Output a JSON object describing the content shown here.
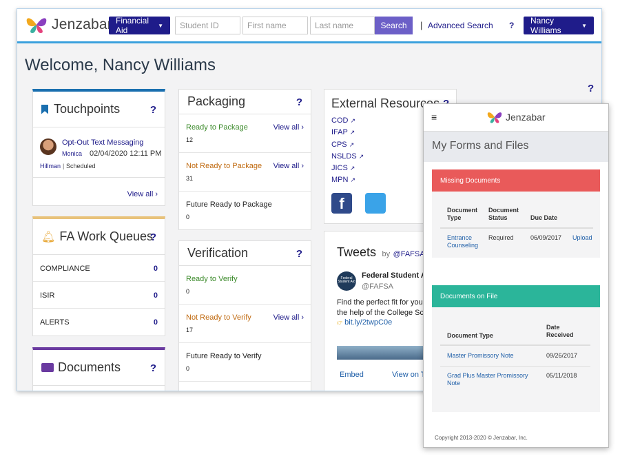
{
  "brand": {
    "name": "Jenzabar"
  },
  "topbar": {
    "module_label": "Financial Aid",
    "student_id_placeholder": "Student ID",
    "first_name_placeholder": "First name",
    "last_name_placeholder": "Last name",
    "search_label": "Search",
    "separator": "|",
    "advanced_search_label": "Advanced Search",
    "help_label": "?",
    "user_label": "Nancy Williams"
  },
  "welcome": {
    "text": "Welcome, Nancy Williams",
    "help_label": "?"
  },
  "touchpoints": {
    "title": "Touchpoints",
    "help_label": "?",
    "item": {
      "title": "Opt-Out Text Messaging",
      "first_name": "Monica",
      "datetime": "02/04/2020 12:11 PM",
      "last_name": "Hillman",
      "divider": "|",
      "status": "Scheduled"
    },
    "view_all": "View all ›"
  },
  "work_queues": {
    "title": "FA Work Queues",
    "help_label": "?",
    "items": [
      {
        "label": "COMPLIANCE",
        "count": "0"
      },
      {
        "label": "ISIR",
        "count": "0"
      },
      {
        "label": "ALERTS",
        "count": "0"
      }
    ]
  },
  "documents_card": {
    "title": "Documents",
    "help_label": "?"
  },
  "packaging": {
    "title": "Packaging",
    "help_label": "?",
    "rows": [
      {
        "label": "Ready to Package",
        "value": "12",
        "view_all": "View all ›"
      },
      {
        "label": "Not Ready to Package",
        "value": "31",
        "view_all": "View all ›"
      },
      {
        "label": "Future Ready to Package",
        "value": "0"
      }
    ]
  },
  "verification": {
    "title": "Verification",
    "help_label": "?",
    "rows": [
      {
        "label": "Ready to Verify",
        "value": "0"
      },
      {
        "label": "Not Ready to Verify",
        "value": "17",
        "view_all": "View all ›"
      },
      {
        "label": "Future Ready to Verify",
        "value": "0"
      }
    ]
  },
  "external": {
    "title": "External Resources",
    "help_label": "?",
    "links": [
      "COD",
      "IFAP",
      "CPS",
      "NSLDS",
      "JICS",
      "MPN"
    ]
  },
  "tweets": {
    "title": "Tweets",
    "by": "by",
    "handle": "@FAFSA",
    "author": "Federal Student Ai",
    "author_handle": "@FAFSA",
    "avatar_text": "Federal Student Aid",
    "line1": "Find the perfect fit for you w",
    "line2": "the help of the College Scor",
    "link": "bit.ly/2twpC0e",
    "embed": "Embed",
    "view_on": "View on T"
  },
  "mobile": {
    "menu_icon": "hamburger-icon",
    "brand": "Jenzabar",
    "page_title": "My Forms and Files",
    "missing": {
      "title": "Missing Documents",
      "color": "#e95a5a",
      "headers": [
        "Document Type",
        "Document Status",
        "Due Date"
      ],
      "row": {
        "type": "Entrance Counseling",
        "status": "Required",
        "due": "06/09/2017",
        "action": "Upload"
      }
    },
    "on_file": {
      "title": "Documents on File",
      "color": "#2bb59a",
      "headers": [
        "Document Type",
        "Date Received"
      ],
      "rows": [
        {
          "type": "Master Promissory Note",
          "date": "09/26/2017"
        },
        {
          "type": "Grad Plus Master Promissory Note",
          "date": "05/11/2018"
        }
      ]
    },
    "copyright": "Copyright 2013-2020 © Jenzabar, Inc."
  },
  "colors": {
    "primary": "#1f1c8a",
    "accent_blue": "#3aa0dd",
    "touchpoints_bar": "#1a6faf",
    "queues_bar": "#e8c27a",
    "documents_bar": "#6a3aa0",
    "twitter": "#3aa3e8",
    "facebook": "#2f4a8a"
  }
}
